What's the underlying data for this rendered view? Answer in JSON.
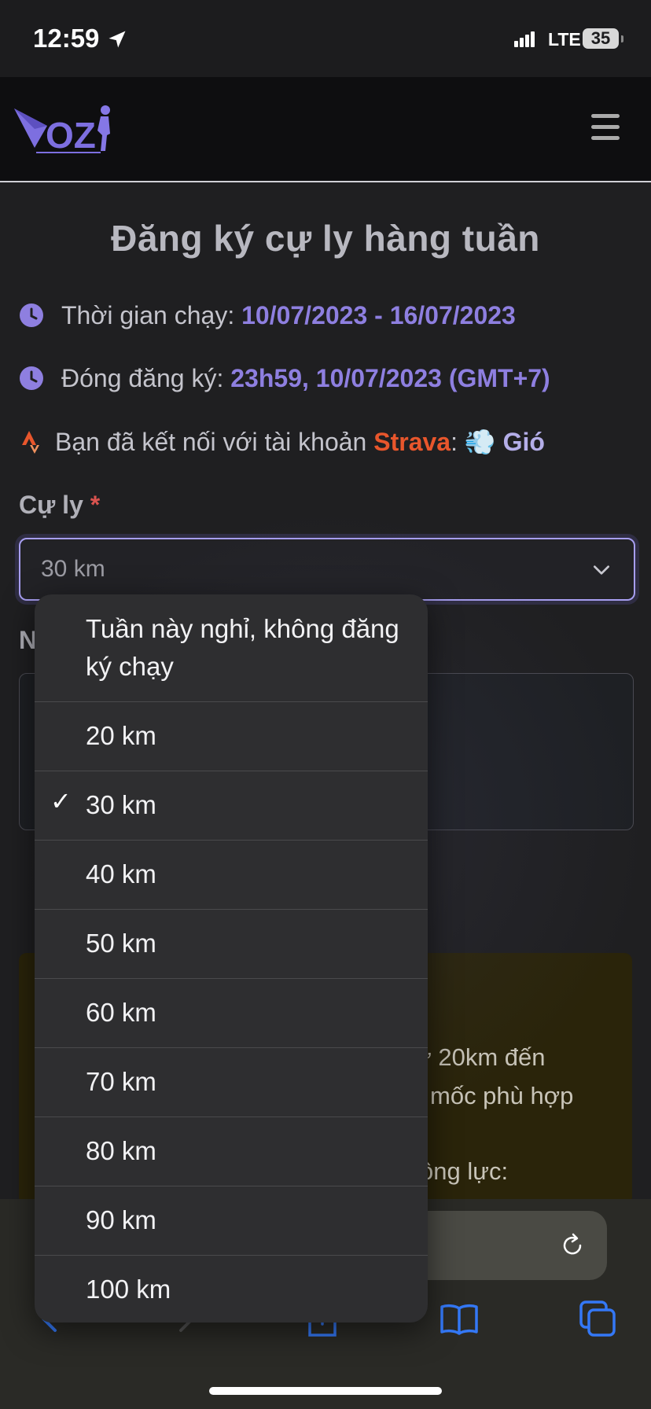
{
  "status_bar": {
    "time": "12:59",
    "network": "LTE",
    "battery": "35"
  },
  "navbar": {
    "logo_text": "OZ"
  },
  "page": {
    "title": "Đăng ký cự ly hàng tuần",
    "run_time_label": "Thời gian chạy: ",
    "run_time_value": "10/07/2023 - 16/07/2023",
    "close_label": "Đóng đăng ký: ",
    "close_value": "23h59, 10/07/2023 (GMT+7)",
    "strava_prefix": "Bạn đã kết nối với tài khoản ",
    "strava_name": "Strava",
    "strava_sep": ": ",
    "strava_user_emoji": "💨",
    "strava_user": "Gió",
    "distance_label": "Cự ly",
    "required_mark": "*",
    "distance_selected": "30 km",
    "second_label_fragment": "N"
  },
  "notice": {
    "line1": "ừ 20km đến",
    "line2": "mốc phù hợp",
    "line3": "ộng lực:"
  },
  "dropdown": {
    "selected_index": 2,
    "options": [
      "Tuần này nghỉ, không đăng ký chạy",
      "20 km",
      "30 km",
      "40 km",
      "50 km",
      "60 km",
      "70 km",
      "80 km",
      "90 km",
      "100 km"
    ]
  },
  "colors": {
    "accent": "#8e7fe0",
    "strava": "#e8562c",
    "required": "#d9534f",
    "toolbar_icon": "#3478f6"
  }
}
